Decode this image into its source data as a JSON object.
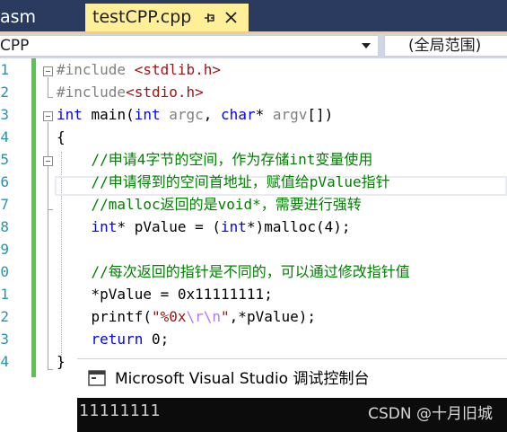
{
  "tabs": {
    "previous_label": "asm",
    "active_label": "testCPP.cpp"
  },
  "navbar": {
    "file_label": "CPP",
    "scope_label": "(全局范围)"
  },
  "editor": {
    "line_numbers": [
      "1",
      "2",
      "3",
      "4",
      "5",
      "6",
      "7",
      "8",
      "9",
      "0",
      "1",
      "2",
      "3",
      "4"
    ],
    "line1": {
      "directive": "#include ",
      "header": "<stdlib.h>"
    },
    "line2": {
      "directive": "#include",
      "header": "<stdio.h>"
    },
    "line3": {
      "type_int": "int",
      "name": " main(",
      "type_int2": "int",
      "param1": " argc",
      "comma": ", ",
      "type_char": "char",
      "star": "* ",
      "param2": "argv",
      "brackets": "[])"
    },
    "line4": "{",
    "line5": "    //申请4字节的空间，作为存储int变量使用",
    "line6": "    //申请得到的空间首地址，赋值给pValue指针",
    "line7": "    //malloc返回的是void*，需要进行强转",
    "line8": {
      "indent": "    ",
      "type_int": "int",
      "rest1": "* pValue = (",
      "type_int2": "int",
      "rest2": "*)malloc(4);"
    },
    "line10": "    //每次返回的指针是不同的，可以通过修改指针值",
    "line11": "    *pValue = 0x11111111;",
    "line12": {
      "indent": "    ",
      "fn": "printf(",
      "str1": "\"%0x",
      "esc": "\\r\\n",
      "str2": "\"",
      "rest": ",*pValue);"
    },
    "line13": {
      "indent": "    ",
      "kw": "return",
      "rest": " 0;"
    },
    "line14": "}"
  },
  "console": {
    "title": "Microsoft Visual Studio 调试控制台",
    "output": "11111111",
    "watermark": "CSDN @十月旧城"
  },
  "colors": {
    "tab_bar": "#2a3b5f",
    "active_tab": "#ffef99",
    "keyword": "#0000ff",
    "comment": "#008000",
    "string": "#a31515",
    "line_number": "#2b91af",
    "changed_line_marker": "#57c74b",
    "console_background": "#0c0c0c"
  },
  "icons": {
    "pin": "pin-icon",
    "close": "close-icon",
    "dropdown": "chevron-down-icon",
    "console_app": "console-window-icon"
  }
}
